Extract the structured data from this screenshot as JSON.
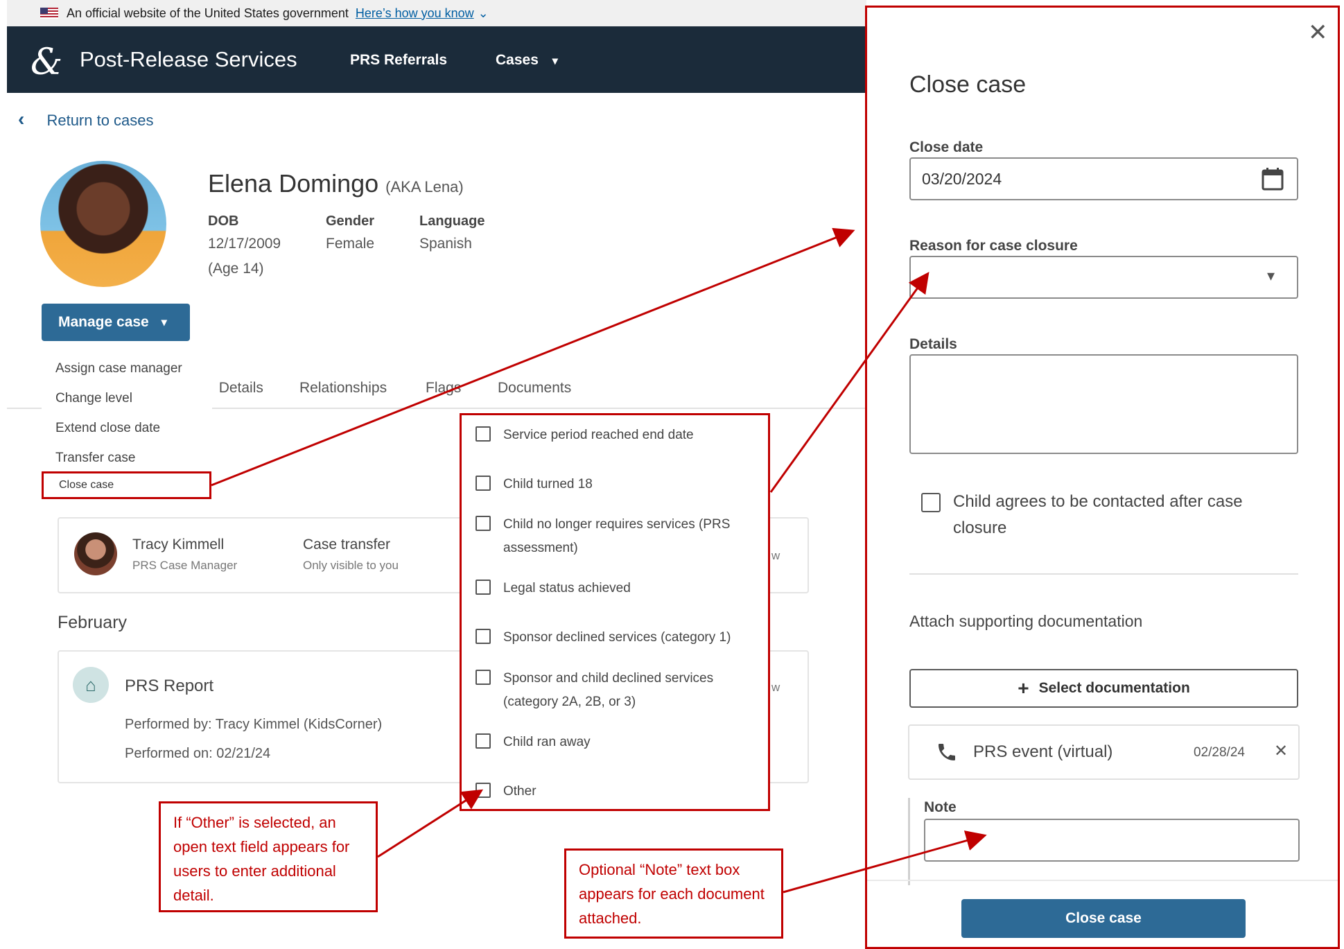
{
  "gov_banner": {
    "text": "An official website of the United States government",
    "link": "Here’s how you know",
    "chevron": "⌄"
  },
  "header": {
    "logo_glyph": "&",
    "site_title": "Post-Release Services",
    "nav": [
      "PRS Referrals",
      "Cases"
    ],
    "cases_caret": "▾"
  },
  "back": {
    "chevron": "‹",
    "label": "Return to cases"
  },
  "person": {
    "name": "Elena Domingo",
    "aka": "(AKA Lena)",
    "dob_label": "DOB",
    "dob": "12/17/2009",
    "age": "(Age 14)",
    "gender_label": "Gender",
    "gender": "Female",
    "language_label": "Language",
    "language": "Spanish"
  },
  "manage": {
    "label": "Manage case",
    "caret": "▾"
  },
  "menu": [
    "Assign case manager",
    "Change level",
    "Extend close date",
    "Transfer case",
    "Close case"
  ],
  "tabs": [
    "Details",
    "Relationships",
    "Flags",
    "Documents"
  ],
  "tabs_partial_prefix": ":",
  "case_manager": {
    "name": "Tracy Kimmell",
    "role": "PRS Case Manager",
    "event": "Case transfer",
    "visibility": "Only visible to you",
    "clipped": "w"
  },
  "month": "February",
  "report": {
    "home_icon": "⌂",
    "title": "PRS Report",
    "performed_by": "Performed by: Tracy Kimmel (KidsCorner)",
    "performed_on": "Performed on: 02/21/24",
    "clipped": "w"
  },
  "reasons": [
    "Service period reached end date",
    "Child turned 18",
    "Child no longer requires services (PRS assessment)",
    "Legal status achieved",
    "Sponsor declined services (category 1)",
    "Sponsor and child declined services (category 2A, 2B, or 3)",
    "Child ran away",
    "Other"
  ],
  "annotations": {
    "other": "If “Other” is selected, an open text field appears for users to enter additional detail.",
    "note": "Optional “Note” text box appears for each document attached."
  },
  "panel": {
    "close_glyph": "✕",
    "title": "Close case",
    "close_date_label": "Close date",
    "close_date_value": "03/20/2024",
    "reason_label": "Reason for case closure",
    "reason_caret": "▾",
    "details_label": "Details",
    "contact_checkbox_label": "Child agrees to be contacted after case closure",
    "attach_title": "Attach supporting documentation",
    "select_doc_plus": "+",
    "select_doc_label": "Select documentation",
    "doc_name": "PRS event (virtual)",
    "doc_date": "02/28/24",
    "doc_remove_glyph": "✕",
    "note_label": "Note",
    "submit_label": "Close case"
  },
  "icons": {
    "calendar": "calendar-icon",
    "phone": "phone-icon",
    "home": "home-icon",
    "flag": "us-flag-icon"
  },
  "colors": {
    "header_bg": "#1b2b3a",
    "primary": "#2d6a96",
    "annotation_red": "#c00000",
    "link": "#1f5a8a"
  }
}
